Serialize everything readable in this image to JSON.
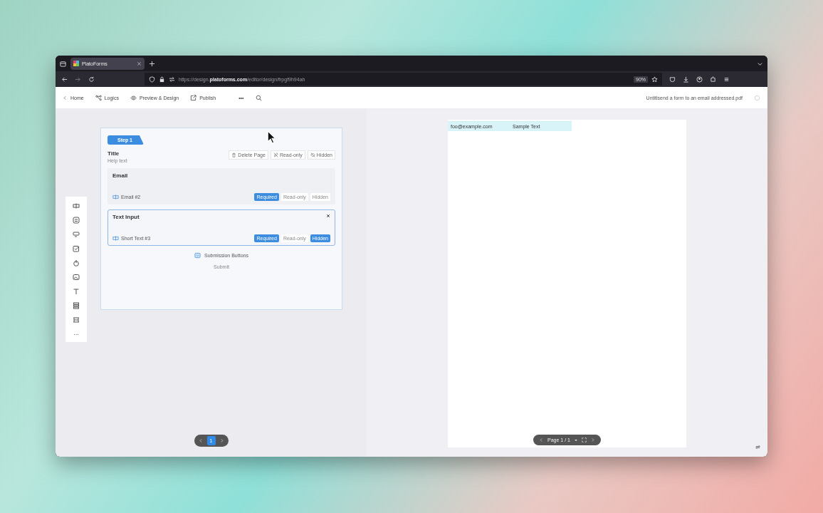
{
  "browser": {
    "tab_title": "PlatoForms",
    "url": "https://design.**platoforms.com**/editor/design/frpgf9h94ah",
    "zoom": "90%"
  },
  "toolbar": {
    "items": [
      {
        "kind": "back",
        "label": "Home"
      },
      {
        "kind": "logic",
        "label": "Logics"
      },
      {
        "kind": "eye",
        "label": "Preview & Design"
      },
      {
        "kind": "share",
        "label": "Publish"
      }
    ],
    "more": "•••",
    "document_name": "Untitlsend a form to an email addressed.pdf"
  },
  "palette": [
    {
      "kind": "textfield"
    },
    {
      "kind": "choice"
    },
    {
      "kind": "dropdown"
    },
    {
      "kind": "checkbox"
    },
    {
      "kind": "upload"
    },
    {
      "kind": "image"
    },
    {
      "kind": "text"
    },
    {
      "kind": "layout"
    },
    {
      "kind": "signature"
    }
  ],
  "palette_more": "···",
  "form": {
    "step_tab": "Step 1",
    "title": "Title",
    "help_text": "Help text",
    "page_actions": [
      {
        "kind": "delete",
        "label": "Delete Page"
      },
      {
        "kind": "readonly",
        "label": "Read-only"
      },
      {
        "kind": "hidden",
        "label": "Hidden"
      }
    ],
    "fields": [
      {
        "title": "Email",
        "name": "Email #2",
        "selected": false,
        "toggles": [
          {
            "label": "Required",
            "on": true
          },
          {
            "label": "Read-only",
            "on": false
          },
          {
            "label": "Hidden",
            "on": false
          }
        ]
      },
      {
        "title": "Text Input",
        "name": "Short Text #3",
        "selected": true,
        "toggles": [
          {
            "label": "Required",
            "on": true
          },
          {
            "label": "Read-only",
            "on": false
          },
          {
            "label": "Hidden",
            "on": true
          }
        ]
      }
    ],
    "submission_label": "Submission Buttons",
    "submit": "Submit"
  },
  "pager": [
    {
      "label": "1",
      "selected": true
    }
  ],
  "pdf": {
    "overlays": [
      {
        "text": "foo@example.com"
      },
      {
        "text": "Sample Text"
      }
    ],
    "page_nav": "Page 1 / 1"
  }
}
